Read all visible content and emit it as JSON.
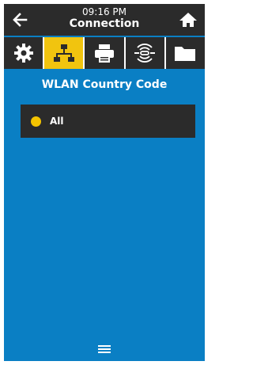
{
  "header": {
    "time": "09:16 PM",
    "title": "Connection",
    "back_icon": "arrow-left-icon",
    "home_icon": "home-icon"
  },
  "tabs": [
    {
      "name": "settings",
      "icon": "gear-icon",
      "active": false
    },
    {
      "name": "network",
      "icon": "network-icon",
      "active": true
    },
    {
      "name": "print",
      "icon": "printer-icon",
      "active": false
    },
    {
      "name": "rfid",
      "icon": "rfid-icon",
      "active": false
    },
    {
      "name": "storage",
      "icon": "folder-icon",
      "active": false
    }
  ],
  "main": {
    "section_title": "WLAN Country Code",
    "options": [
      {
        "label": "All",
        "selected": true
      }
    ]
  },
  "footer": {
    "menu_icon": "menu-icon"
  },
  "colors": {
    "background": "#0a7fc4",
    "bar": "#2b2b2b",
    "accent": "#f1c40f"
  }
}
